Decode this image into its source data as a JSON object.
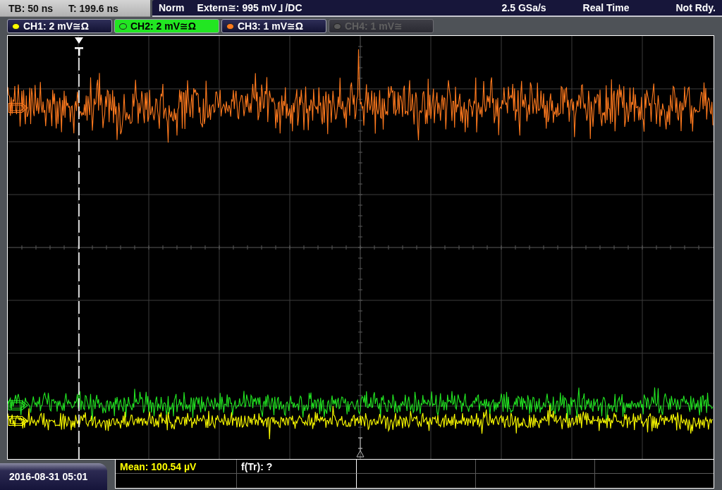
{
  "status_bar": {
    "timebase": "TB: 50 ns",
    "trigger_time": "T: 199.6 ns",
    "trigger_mode": "Norm",
    "trigger_source": "Extern≅: 995 mV",
    "coupling": "/DC",
    "sample_rate": "2.5 GSa/s",
    "acquisition_mode": "Real Time",
    "status": "Not Rdy."
  },
  "channels": [
    {
      "label": "CH1: 2 mV≅Ω",
      "color": "#ffff00",
      "selected": false,
      "disabled": false
    },
    {
      "label": "CH2: 2 mV≅Ω",
      "color": "#22e622",
      "selected": true,
      "disabled": false
    },
    {
      "label": "CH3: 1 mV≅Ω",
      "color": "#ff7a1e",
      "selected": false,
      "disabled": false
    },
    {
      "label": "CH4: 1 mV≅",
      "color": "#5a5a5a",
      "selected": false,
      "disabled": true
    }
  ],
  "measurements": [
    {
      "label": "Mean: 100.54 µV",
      "color": "#ffff00"
    },
    {
      "label": "f(Tr): ?",
      "color": "#ffffff"
    }
  ],
  "timestamp": "2016-08-31 05:01"
}
